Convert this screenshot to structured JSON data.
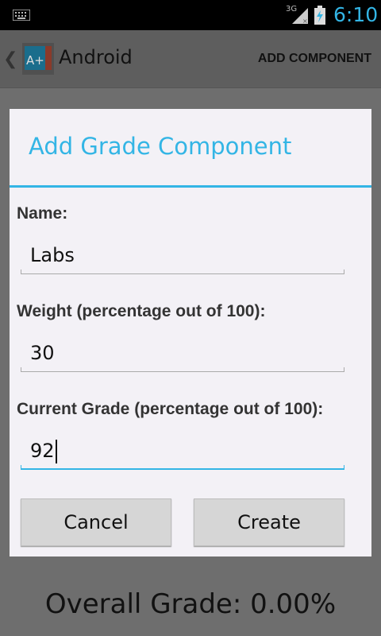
{
  "status_bar": {
    "network": "3G",
    "time": "6:10"
  },
  "action_bar": {
    "app_icon_text": "A+",
    "title": "Android",
    "action": "ADD COMPONENT"
  },
  "background": {
    "overall_grade": "Overall Grade: 0.00%"
  },
  "dialog": {
    "title": "Add Grade Component",
    "fields": [
      {
        "label": "Name:",
        "value": "Labs"
      },
      {
        "label": "Weight (percentage out of 100):",
        "value": "30"
      },
      {
        "label": "Current Grade (percentage out of 100):",
        "value": "92"
      }
    ],
    "cancel_label": "Cancel",
    "create_label": "Create"
  },
  "colors": {
    "accent": "#33b5e5",
    "dialog_bg": "#f3f1f6",
    "button_bg": "#d6d6d6"
  }
}
